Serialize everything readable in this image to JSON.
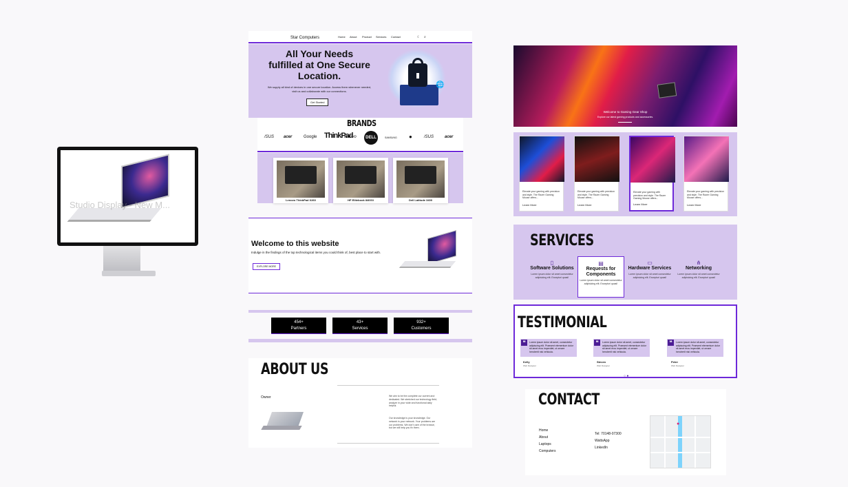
{
  "monitor": {
    "overlay_text": "Studio Display - New M..."
  },
  "nav": {
    "brand": "Star Computers",
    "links": [
      "Home",
      "About",
      "Product",
      "Services",
      "Contact"
    ],
    "icons": [
      "moon-icon",
      "search-icon"
    ]
  },
  "hero": {
    "title_lines": [
      "All Your Needs",
      "fulfilled at One Secure",
      "Location."
    ],
    "subtitle": "We supply all kind of devices in one secure location. Access them whenever needed, visit us and collaborate with our connections.",
    "button": "Get Started"
  },
  "brands": {
    "heading": "BRANDS",
    "items": [
      "/SUS",
      "acer",
      "Google",
      "ThinkPad",
      "lenovo",
      "DELL",
      "SAMSUNG",
      "apple-logo",
      "/SUS",
      "acer"
    ]
  },
  "laptops": [
    "Lenovo ThinkPad X260",
    "HP Elitebook 840G3",
    "Dell Latitude 3400"
  ],
  "welcome": {
    "title": "Welcome to this website",
    "text": "Indulge in the findings of the top technological items you could think of, best place to start with.",
    "button": "EXPLORE MORE"
  },
  "stats": [
    {
      "value": "454+",
      "label": "Partners"
    },
    {
      "value": "43+",
      "label": "Services"
    },
    {
      "value": "932+",
      "label": "Customers"
    }
  ],
  "about": {
    "heading": "ABOUT US",
    "owner": "Owner",
    "p1": "We aim to be the complete our current and dedicated. We stretched our technology field, analyze in your wide and functional daily helpful.",
    "p2": "Our knowledge is your knowledge. Our network is your network. Your problems are our problems. We don't care of the browse, but we will help you fix them."
  },
  "carousel": {
    "title": "Welcome to Gaming Gear Shop",
    "subtitle": "Explore our latest gaming products and accessories."
  },
  "gaming_cards": [
    {
      "text": "Elevate your gaming with precision and style. The Razer Gaming Mouse offers...",
      "link": "Learn More"
    },
    {
      "text": "Elevate your gaming with precision and style. The Razer Gaming Mouse offers...",
      "link": "Learn More"
    },
    {
      "text": "Elevate your gaming with precision and style. The Razer Gaming Mouse offers...",
      "link": "Learn More"
    },
    {
      "text": "Elevate your gaming with precision and style. The Razer Gaming Mouse offers...",
      "link": "Learn More"
    }
  ],
  "services": {
    "heading": "SERVICES",
    "items": [
      {
        "title": "Software Solutions",
        "desc": "Lorem ipsum dolor sit amet consectetur adipisicing elit. Excepturi quasi!"
      },
      {
        "title": "Requests for Components",
        "desc": "Lorem ipsum dolor sit amet consectetur adipisicing elit. Excepturi quasi!"
      },
      {
        "title": "Hardware Services",
        "desc": "Lorem ipsum dolor sit amet consectetur adipisicing elit. Excepturi quasi!"
      },
      {
        "title": "Networking",
        "desc": "Lorem ipsum dolor sit amet consectetur adipisicing elit. Excepturi quasi!"
      }
    ]
  },
  "testimonial": {
    "heading": "TESTIMONIAL",
    "items": [
      {
        "quote": "Lorem ipsum dolor sit amet, consectetur adipiscing elit. Praesent elementum dolor sit amet eros imperdiet, ut ornare hendrerit nisi vehicula.",
        "name": "Kelly",
        "role": "Web Designer"
      },
      {
        "quote": "Lorem ipsum dolor sit amet, consectetur adipiscing elit. Praesent elementum dolor sit amet eros imperdiet, ut ornare hendrerit nisi vehicula.",
        "name": "Steven",
        "role": "Web Designer"
      },
      {
        "quote": "Lorem ipsum dolor sit amet, consectetur adipiscing elit. Praesent elementum dolor sit amet eros imperdiet, ut ornare hendrerit nisi vehicula.",
        "name": "Peter",
        "role": "Web Designer"
      }
    ]
  },
  "contact": {
    "heading": "CONTACT",
    "links": [
      "Home",
      "About",
      "Laptops",
      "Computers"
    ],
    "social": [
      "Tel: 70148-07300",
      "WattsApp",
      "LinkedIn"
    ]
  },
  "colors": {
    "accent": "#6d28d9",
    "lavender": "#d6c6ee",
    "dark_purple": "#4c1d95"
  }
}
